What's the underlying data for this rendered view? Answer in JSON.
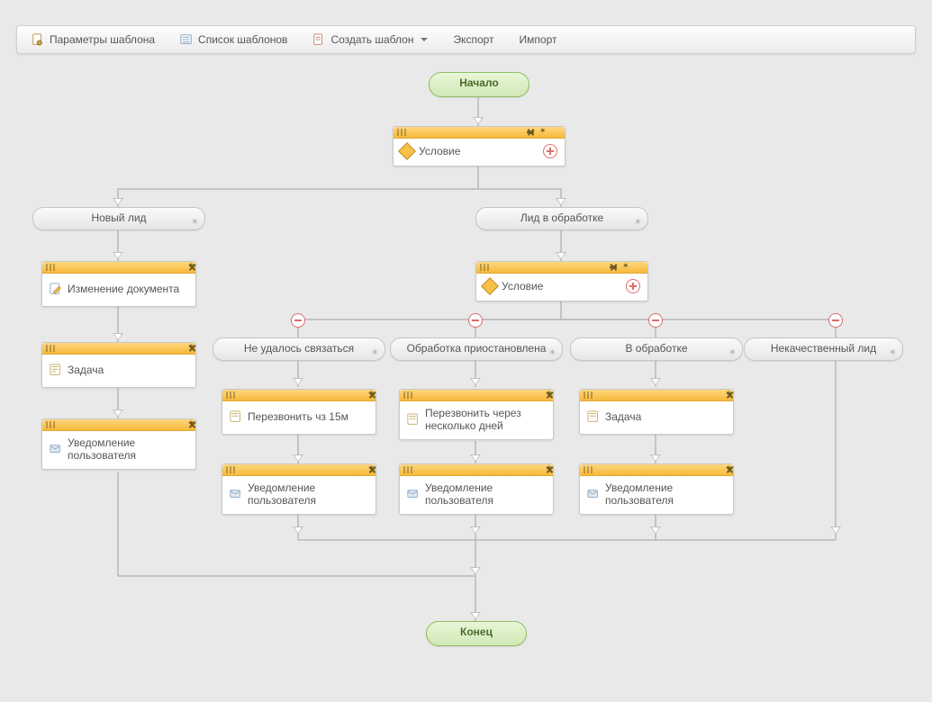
{
  "toolbar": {
    "template_params": "Параметры шаблона",
    "template_list": "Список шаблонов",
    "create_template": "Создать шаблон",
    "export": "Экспорт",
    "import": "Импорт"
  },
  "nodes": {
    "start": "Начало",
    "end": "Конец",
    "condition1": "Условие",
    "condition2": "Условие",
    "branch_new_lead": "Новый лид",
    "branch_in_progress": "Лид в обработке",
    "branch_no_contact": "Не удалось связаться",
    "branch_paused": "Обработка приостановлена",
    "branch_processing": "В обработке",
    "branch_low_quality": "Некачественный лид",
    "change_doc": "Изменение документа",
    "task1": "Задача",
    "notify1": "Уведомление пользователя",
    "callback_15m": "Перезвонить чз 15м",
    "callback_days": "Перезвонить через несколько дней",
    "task2": "Задача",
    "notify2": "Уведомление пользователя",
    "notify3": "Уведомление пользователя",
    "notify4": "Уведомление пользователя"
  },
  "colors": {
    "orange_head": "#f7b93a",
    "green_start": "#d0e9b6",
    "wire": "#b8b8b8"
  }
}
